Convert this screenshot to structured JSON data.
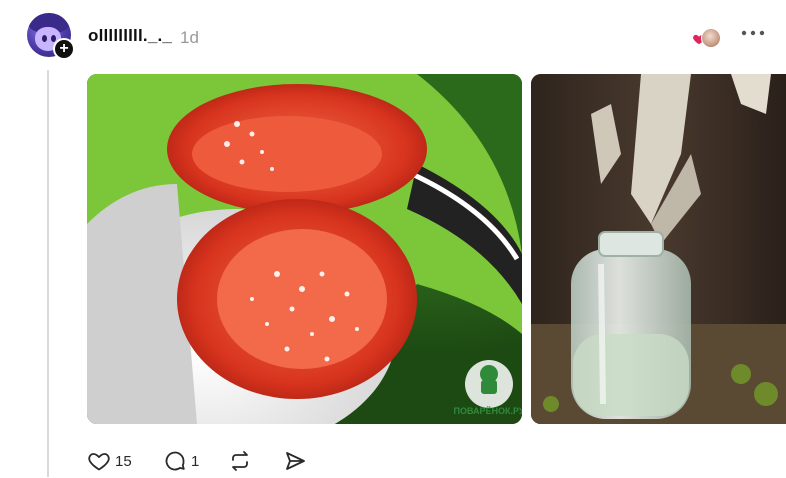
{
  "post": {
    "username": "olllllllll._._",
    "timestamp": "1d",
    "images": [
      {
        "icon": "tomato-photo",
        "watermark": "ПОВАРЁНОК.РУ"
      },
      {
        "icon": "birch-sap-jar-photo"
      }
    ]
  },
  "actions": {
    "like_count": "15",
    "reply_count": "1"
  },
  "colors": {
    "text": "#101010",
    "muted": "#999999",
    "like_red": "#e0245e",
    "thread_line": "#d9d9d9"
  }
}
